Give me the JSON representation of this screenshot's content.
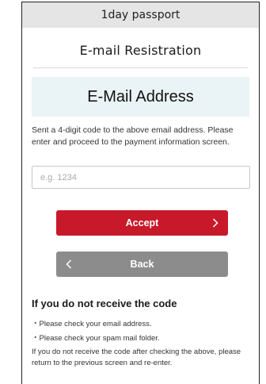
{
  "header": {
    "title": "1day passport"
  },
  "page": {
    "title": "E-mail Resistration"
  },
  "email_display": {
    "value": "E-Mail Address"
  },
  "instructions": "Sent a 4-digit code to the above email address. Please enter and proceed to the payment information screen.",
  "code_input": {
    "placeholder": "e.g. 1234",
    "value": ""
  },
  "buttons": {
    "accept_label": "Accept",
    "back_label": "Back",
    "accept_color": "#c8192b",
    "back_color": "#8c8c8c"
  },
  "icons": {
    "accept_chevron": "chevron-right-icon",
    "back_chevron": "chevron-left-icon"
  },
  "help": {
    "title": "If you do not receive the code",
    "bullets": [
      "・Please check your email address.",
      "・Please check your spam mail folder."
    ],
    "note": "If you do not receive the code after checking the above, please return to the previous screen and re-enter."
  }
}
